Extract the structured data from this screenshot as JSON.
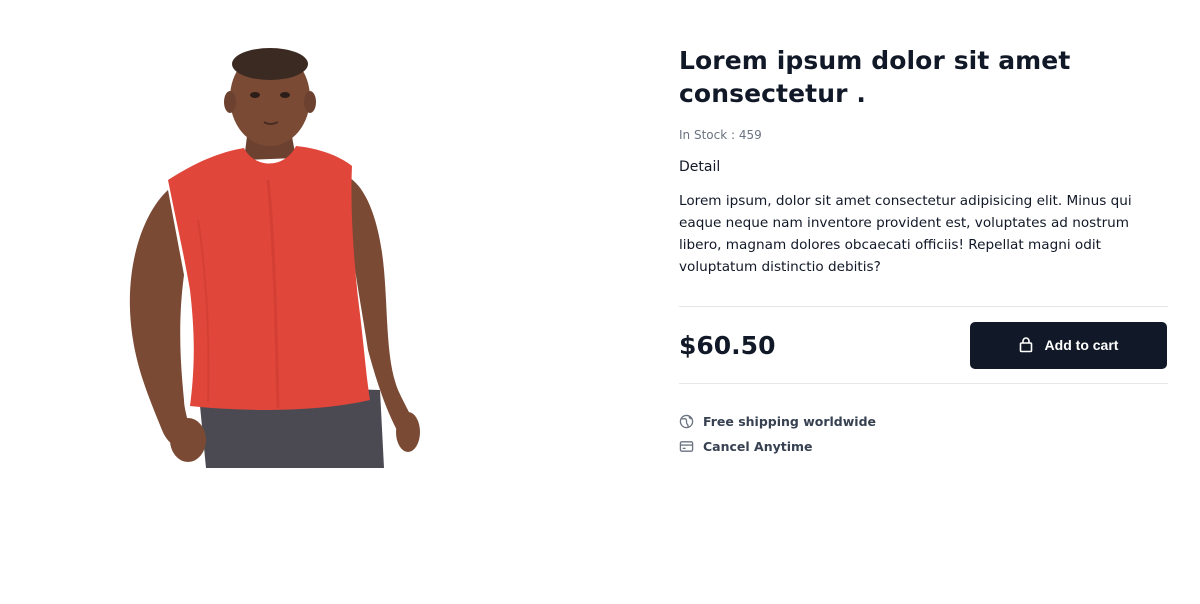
{
  "product": {
    "title": "Lorem ipsum dolor sit amet consectetur .",
    "stock_label": "In Stock : 459",
    "detail_heading": "Detail",
    "description": "Lorem ipsum, dolor sit amet consectetur adipisicing elit. Minus qui eaque neque nam inventore provident est, voluptates ad nostrum libero, magnam dolores obcaecati officiis! Repellat magni odit voluptatum distinctio debitis?",
    "price": "$60.50",
    "image_icon": "product-photo-red-tank-top"
  },
  "cart": {
    "button_label": "Add to cart",
    "icon": "shopping-bag-icon",
    "button_color": "#111827"
  },
  "perks": [
    {
      "icon": "globe-icon",
      "label": "Free shipping worldwide"
    },
    {
      "icon": "credit-card-icon",
      "label": "Cancel Anytime"
    }
  ]
}
